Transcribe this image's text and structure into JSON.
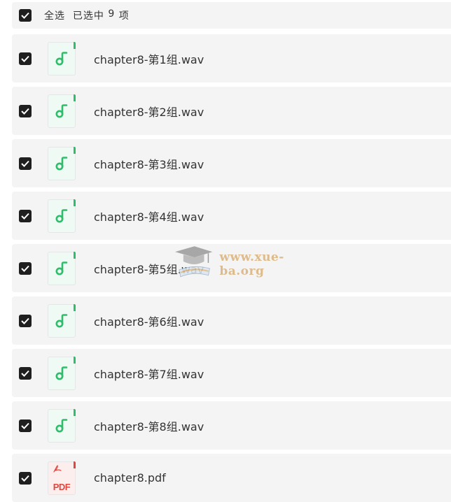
{
  "selection": {
    "select_all_label": "全选",
    "selected_prefix": "已选中",
    "selected_count": "9",
    "selected_suffix": "项",
    "checked": true
  },
  "files": [
    {
      "name": "chapter8-第1组.wav",
      "type": "audio",
      "icon": "music-note-icon",
      "checked": true
    },
    {
      "name": "chapter8-第2组.wav",
      "type": "audio",
      "icon": "music-note-icon",
      "checked": true
    },
    {
      "name": "chapter8-第3组.wav",
      "type": "audio",
      "icon": "music-note-icon",
      "checked": true
    },
    {
      "name": "chapter8-第4组.wav",
      "type": "audio",
      "icon": "music-note-icon",
      "checked": true
    },
    {
      "name": "chapter8-第5组.wav",
      "type": "audio",
      "icon": "music-note-icon",
      "checked": true
    },
    {
      "name": "chapter8-第6组.wav",
      "type": "audio",
      "icon": "music-note-icon",
      "checked": true
    },
    {
      "name": "chapter8-第7组.wav",
      "type": "audio",
      "icon": "music-note-icon",
      "checked": true
    },
    {
      "name": "chapter8-第8组.wav",
      "type": "audio",
      "icon": "music-note-icon",
      "checked": true
    },
    {
      "name": "chapter8.pdf",
      "type": "pdf",
      "icon": "pdf-file-icon",
      "icon_label": "PDF",
      "checked": true
    }
  ],
  "watermark": {
    "text": "www.xue-ba.org"
  },
  "colors": {
    "row_bg": "#f4f4f4",
    "checkbox": "#1f1f1f",
    "audio_accent": "#2ebd6b",
    "pdf_accent": "#e0463e",
    "text": "#333333",
    "watermark": "#d9b27a"
  }
}
